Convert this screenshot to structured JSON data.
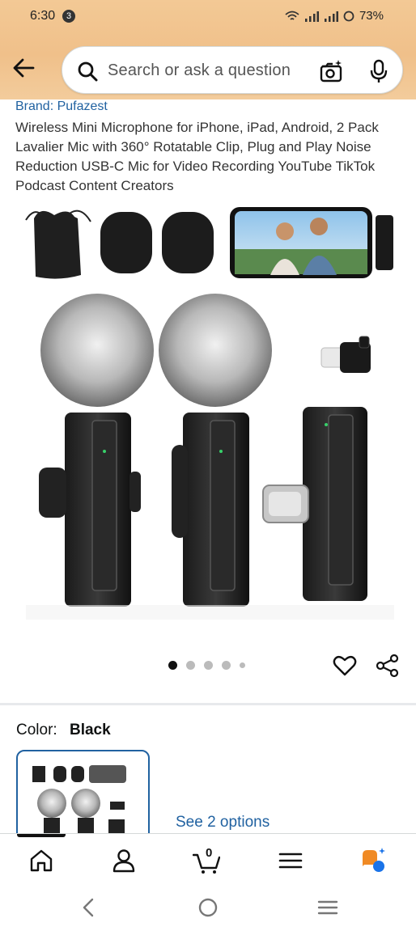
{
  "status_bar": {
    "time": "6:30",
    "notification_count": "3",
    "battery": "73%"
  },
  "search": {
    "placeholder": "Search or ask a question"
  },
  "product": {
    "brand": "Brand: Pufazest",
    "title": "Wireless Mini Microphone for iPhone, iPad, Android, 2 Pack Lavalier Mic with 360° Rotatable Clip, Plug and Play Noise Reduction USB-C Mic for Video Recording YouTube TikTok Podcast Content Creators",
    "image_count": 5,
    "active_image_index": 0
  },
  "variation": {
    "color_label": "Color:",
    "color_value": "Black",
    "see_options": "See 2 options"
  },
  "bottom_nav": {
    "cart_count": "0"
  },
  "colors": {
    "accent_link": "#2162a1",
    "header_bg": "#f3c995",
    "ai_orange": "#f08a24",
    "ai_blue": "#1a73e8"
  },
  "icons": [
    "back-arrow-icon",
    "search-icon",
    "camera-search-icon",
    "microphone-icon",
    "heart-icon",
    "share-icon",
    "home-icon",
    "account-icon",
    "cart-icon",
    "menu-icon",
    "rufus-ai-icon",
    "system-back-icon",
    "system-home-icon",
    "system-recents-icon"
  ]
}
